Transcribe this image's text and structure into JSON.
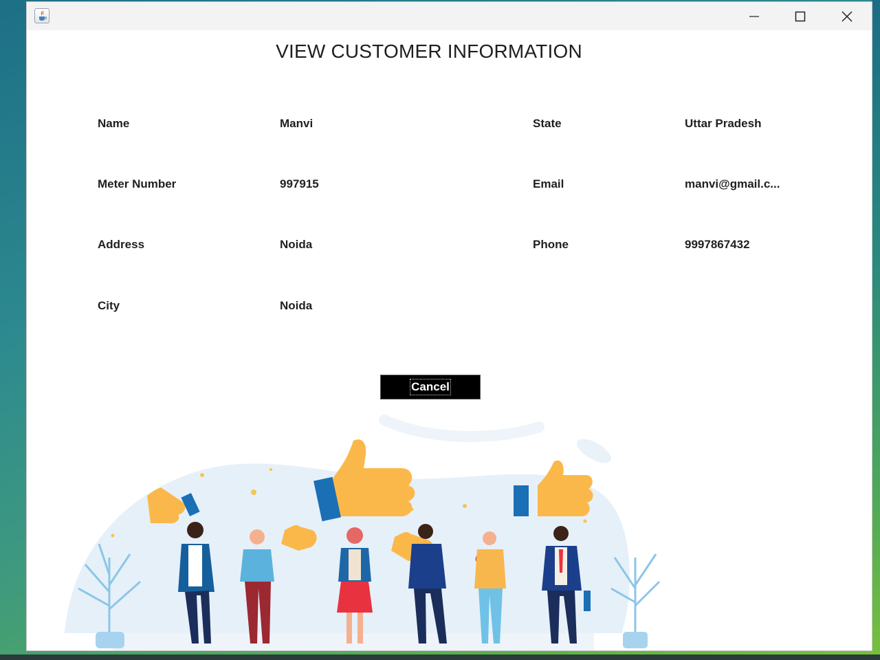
{
  "window": {
    "app_icon": "java-cup-icon",
    "controls": [
      "minimize-icon",
      "maximize-icon",
      "close-icon"
    ]
  },
  "page": {
    "title": "VIEW CUSTOMER INFORMATION"
  },
  "fields": {
    "name": {
      "label": "Name",
      "value": "Manvi"
    },
    "meter": {
      "label": "Meter Number",
      "value": "997915"
    },
    "address": {
      "label": "Address",
      "value": "Noida"
    },
    "city": {
      "label": "City",
      "value": "Noida"
    },
    "state": {
      "label": "State",
      "value": "Uttar Pradesh"
    },
    "email": {
      "label": "Email",
      "value": "manvi@gmail.c..."
    },
    "phone": {
      "label": "Phone",
      "value": "9997867432"
    }
  },
  "actions": {
    "cancel_label": "Cancel"
  },
  "colors": {
    "button_bg": "#000000",
    "thumb_yellow": "#fbb84a",
    "jacket_blue": "#155f9c",
    "cloud_blue": "#e3eef8"
  }
}
